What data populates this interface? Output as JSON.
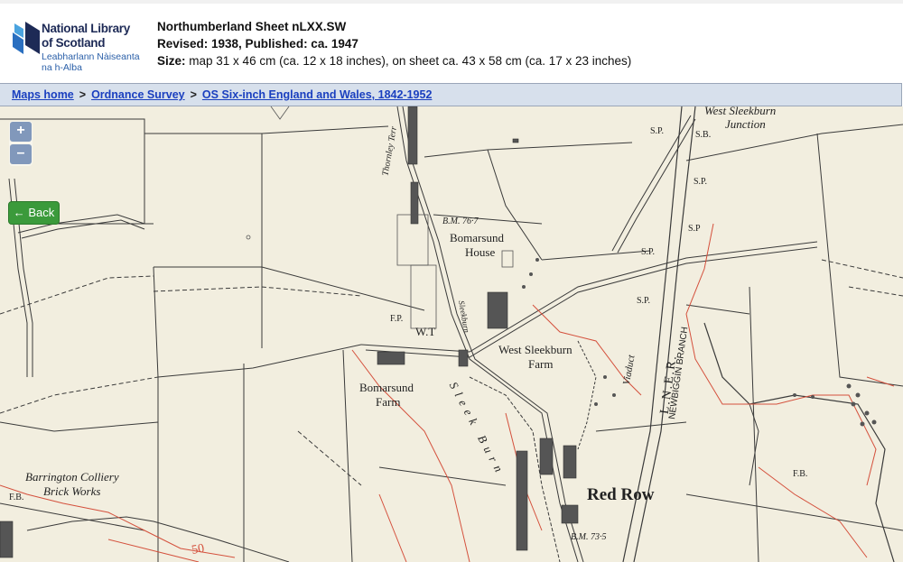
{
  "header": {
    "logo_line1": "National Library",
    "logo_line2": "of Scotland",
    "logo_line3": "Leabharlann Nàiseanta",
    "logo_line4": "na h-Alba",
    "title": "Northumberland Sheet nLXX.SW",
    "revised": "Revised: 1938, Published: ca. 1947",
    "size_label": "Size:",
    "size_text": "map 31 x 46 cm (ca. 12 x 18 inches), on sheet ca. 43 x 58 cm (ca. 17 x 23 inches)"
  },
  "breadcrumb": {
    "items": [
      "Maps home",
      "Ordnance Survey",
      "OS Six-inch England and Wales, 1842-1952"
    ],
    "separator": ">"
  },
  "controls": {
    "zoom_in": "+",
    "zoom_out": "–",
    "back": "← Back"
  },
  "map_labels": {
    "west_sleekburn_junction_1": "West Sleekburn",
    "west_sleekburn_junction_2": "Junction",
    "sp1": "S.P.",
    "sb": "S.B.",
    "sp2": "S.P.",
    "sp3": "S.P",
    "sp4": "S.P.",
    "sp5": "S.P.",
    "thornley_terr": "Thornley Terr",
    "bm_767": "B.M. 76·7",
    "bomarsund_house_1": "Bomarsund",
    "bomarsund_house_2": "House",
    "fp1": "F.P.",
    "wt": "W.T",
    "sleekburn": "Sleekburn",
    "west_sleekburn_farm_1": "West Sleekburn",
    "west_sleekburn_farm_2": "Farm",
    "bomarsund_farm_1": "Bomarsund",
    "bomarsund_farm_2": "Farm",
    "sleek_burn": "Sleek Burn",
    "viaduct": "Viaduct",
    "lner": "L.N.E.R.",
    "newbiggin_branch": "NEWBIGGIN BRANCH",
    "barrington_1": "Barrington Colliery",
    "barrington_2": "Brick Works",
    "fb1": "F.B.",
    "fb2": "F.B.",
    "red_row": "Red Row",
    "bm_735": "B.M. 73·5",
    "contour_50": "50"
  }
}
